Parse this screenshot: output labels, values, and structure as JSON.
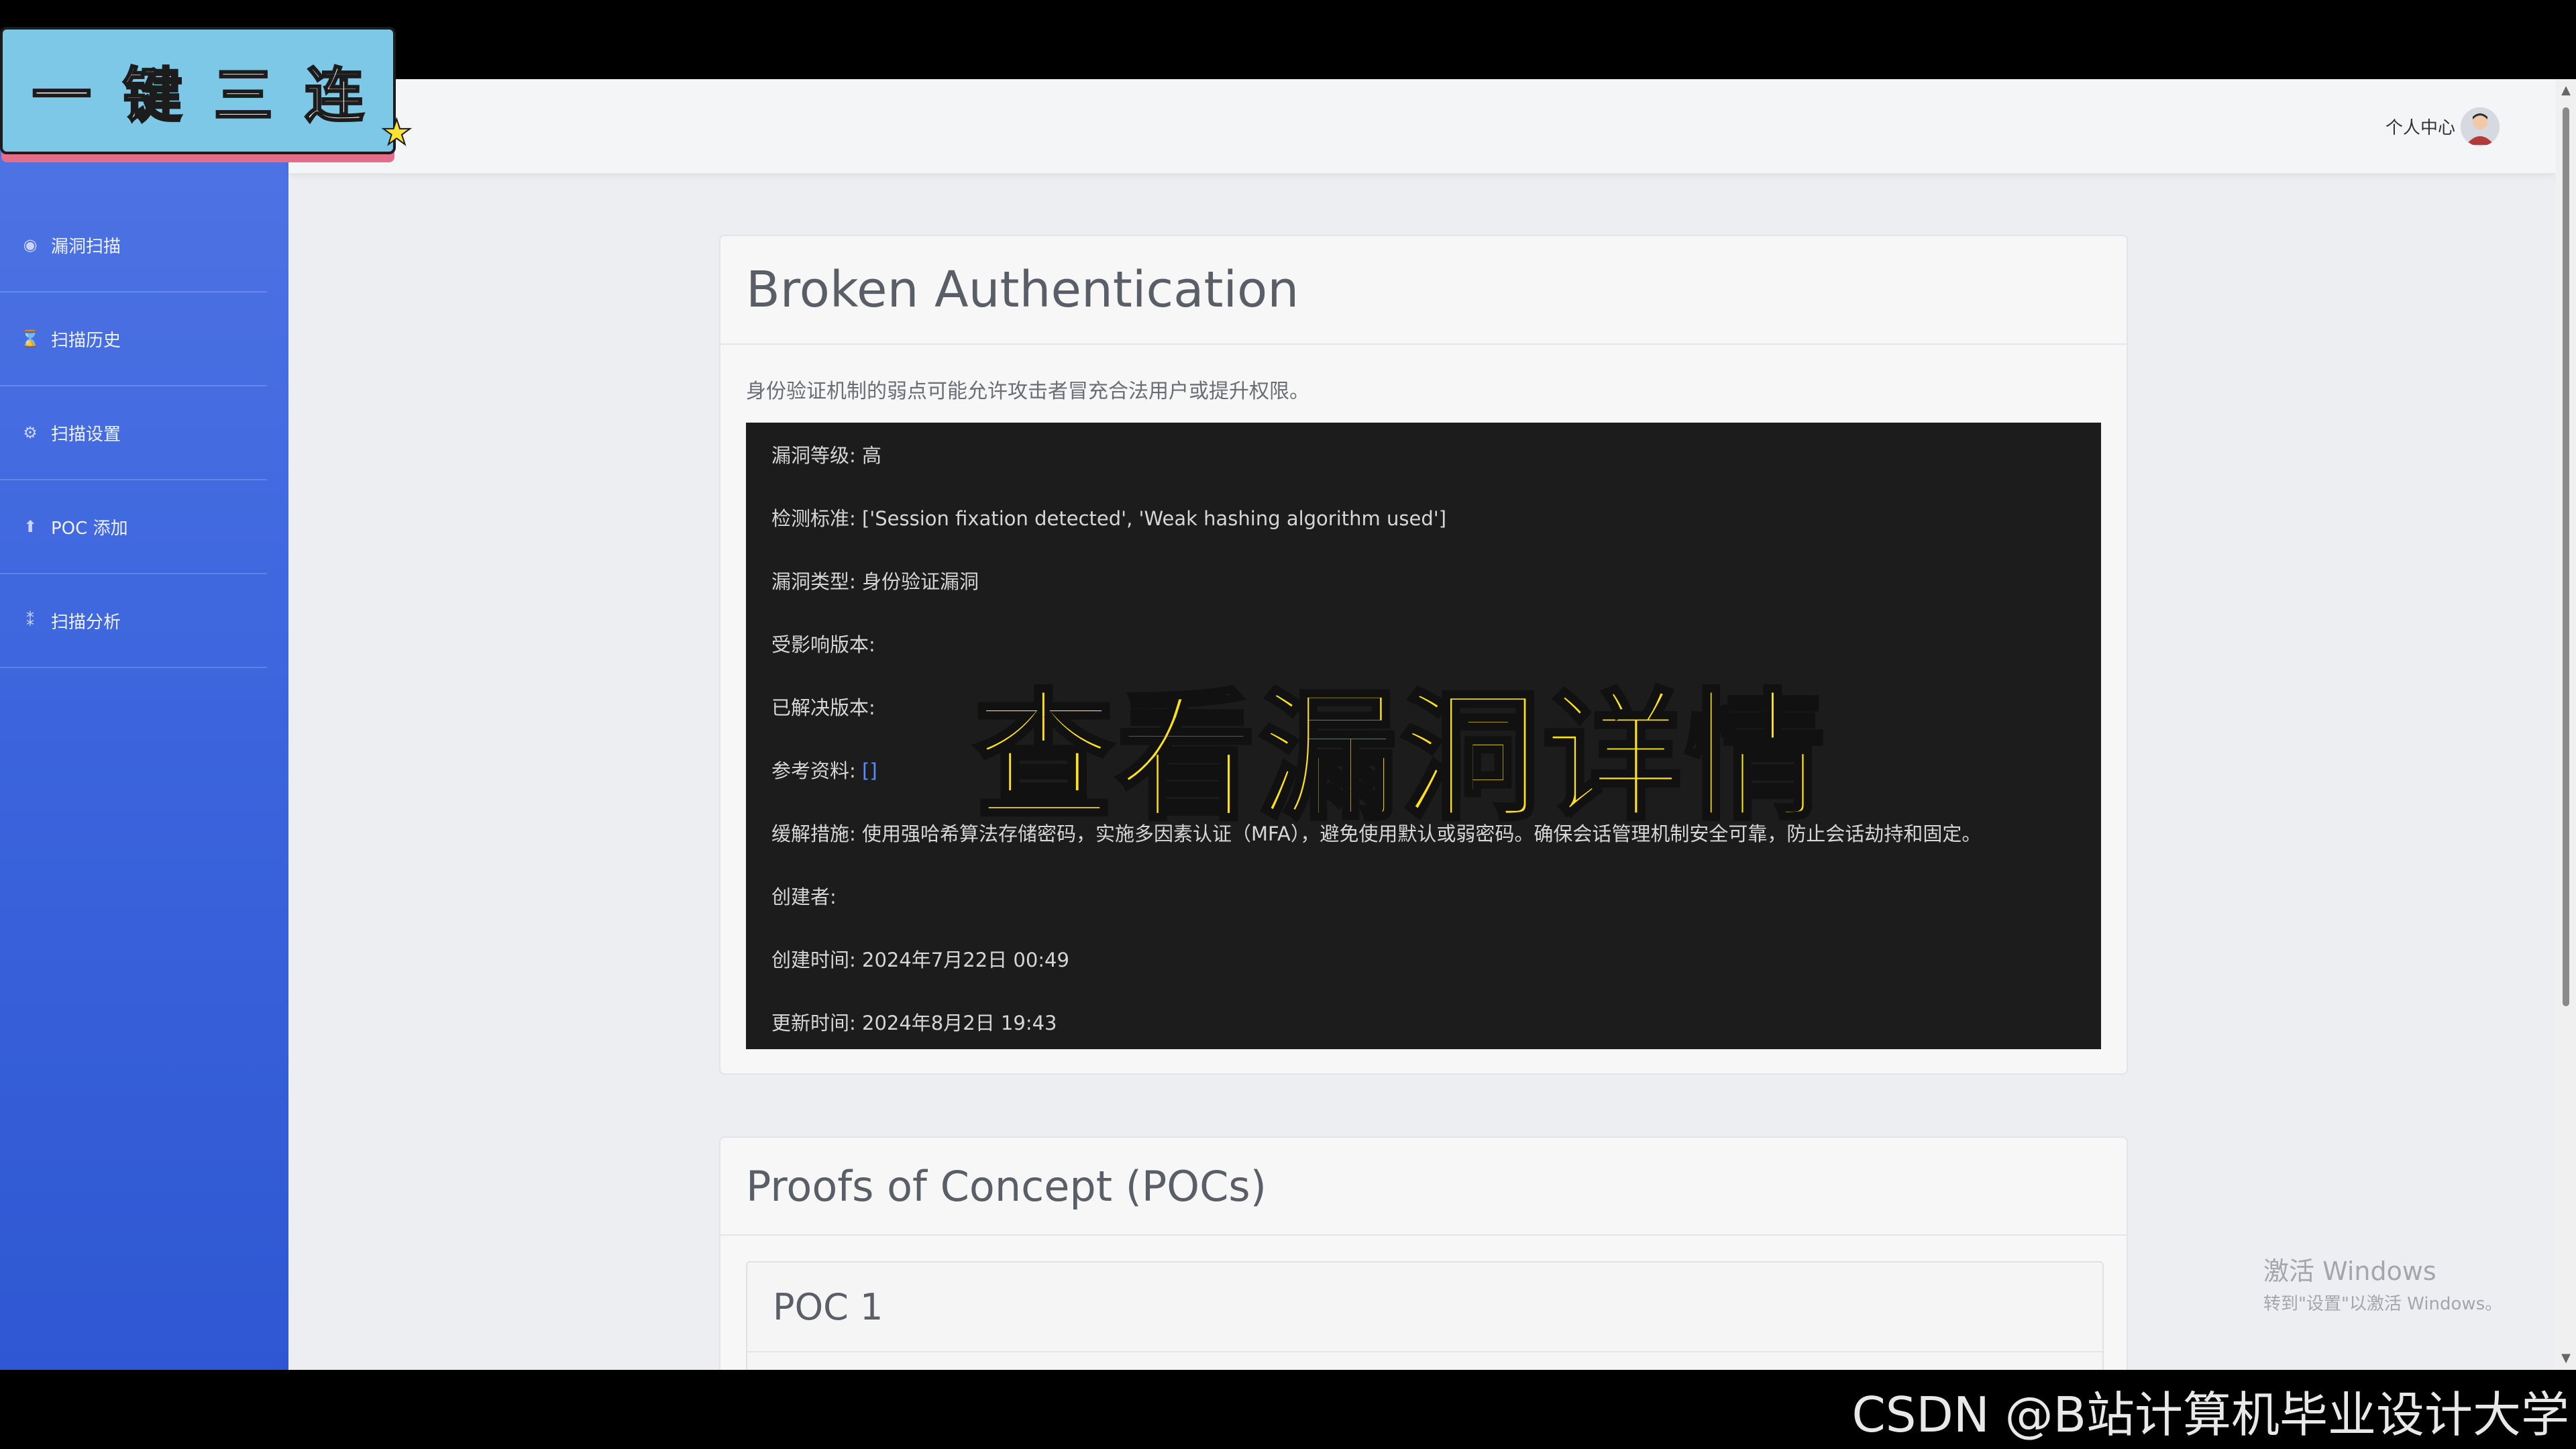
{
  "sidebar": {
    "items": [
      {
        "label": "漏洞扫描",
        "icon": "dashboard-icon"
      },
      {
        "label": "扫描历史",
        "icon": "hourglass-icon"
      },
      {
        "label": "扫描设置",
        "icon": "gear-icon"
      },
      {
        "label": "POC 添加",
        "icon": "user-upload-icon"
      },
      {
        "label": "扫描分析",
        "icon": "chart-icon"
      }
    ]
  },
  "header": {
    "user_center_label": "个人中心"
  },
  "vulnerability": {
    "title": "Broken Authentication",
    "description": "身份验证机制的弱点可能允许攻击者冒充合法用户或提升权限。",
    "details": {
      "severity": "漏洞等级: 高",
      "detection_criteria": "检测标准: ['Session fixation detected', 'Weak hashing algorithm used']",
      "vuln_type": "漏洞类型: 身份验证漏洞",
      "affected_versions": "受影响版本:",
      "fixed_versions": "已解决版本:",
      "references_label": "参考资料: ",
      "references_value": "[]",
      "mitigation": "缓解措施: 使用强哈希算法存储密码，实施多因素认证（MFA），避免使用默认或弱密码。确保会话管理机制安全可靠，防止会话劫持和固定。",
      "creator": "创建者:",
      "created_at": "创建时间: 2024年7月22日 00:49",
      "updated_at": "更新时间: 2024年8月2日 19:43"
    }
  },
  "pocs": {
    "title": "Proofs of Concept (POCs)",
    "items": [
      {
        "title": "POC 1"
      }
    ]
  },
  "windows_watermark": {
    "line1": "激活 Windows",
    "line2": "转到\"设置\"以激活 Windows。"
  },
  "overlay": {
    "banner_chars": [
      "一",
      "键",
      "三",
      "连"
    ],
    "caption": "查看漏洞详情",
    "csdn_watermark": "CSDN @B站计算机毕业设计大学"
  }
}
